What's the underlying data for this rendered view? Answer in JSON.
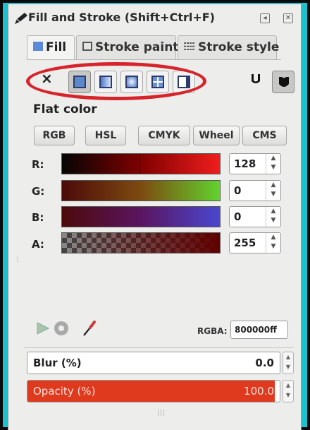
{
  "window": {
    "title": "Fill and Stroke (Shift+Ctrl+F)",
    "title_icon": "pen-icon",
    "buttons": [
      "pin-icon",
      "close-icon"
    ]
  },
  "tabs": [
    {
      "label": "Fill",
      "icon": "fill-square-icon",
      "active": true
    },
    {
      "label": "Stroke paint",
      "icon": "stroke-square-icon",
      "active": false
    },
    {
      "label": "Stroke style",
      "icon": "stroke-lines-icon",
      "active": false
    }
  ],
  "paint_types": {
    "none_label": "×",
    "items": [
      "flat-color",
      "linear-gradient",
      "radial-gradient",
      "pattern",
      "swatch"
    ],
    "selected": "flat-color",
    "fill_rules": [
      "evenodd-icon",
      "nonzero-icon"
    ]
  },
  "fill": {
    "section_title": "Flat color",
    "modes": [
      "RGB",
      "HSL",
      "CMYK",
      "Wheel",
      "CMS"
    ],
    "channels": [
      {
        "label": "R:",
        "value": "128"
      },
      {
        "label": "G:",
        "value": "0"
      },
      {
        "label": "B:",
        "value": "0"
      },
      {
        "label": "A:",
        "value": "255"
      }
    ],
    "rgba_label": "RGBA:",
    "rgba_value": "800000ff"
  },
  "blur": {
    "label": "Blur (%)",
    "value": "0.0"
  },
  "opacity": {
    "label": "Opacity (%)",
    "value": "100.0",
    "level": 0.98
  },
  "colors": {
    "background": "#19c2cf",
    "panel": "#ededeb",
    "highlight": "#d8232a",
    "opacity_bar": "#e03a1e"
  }
}
